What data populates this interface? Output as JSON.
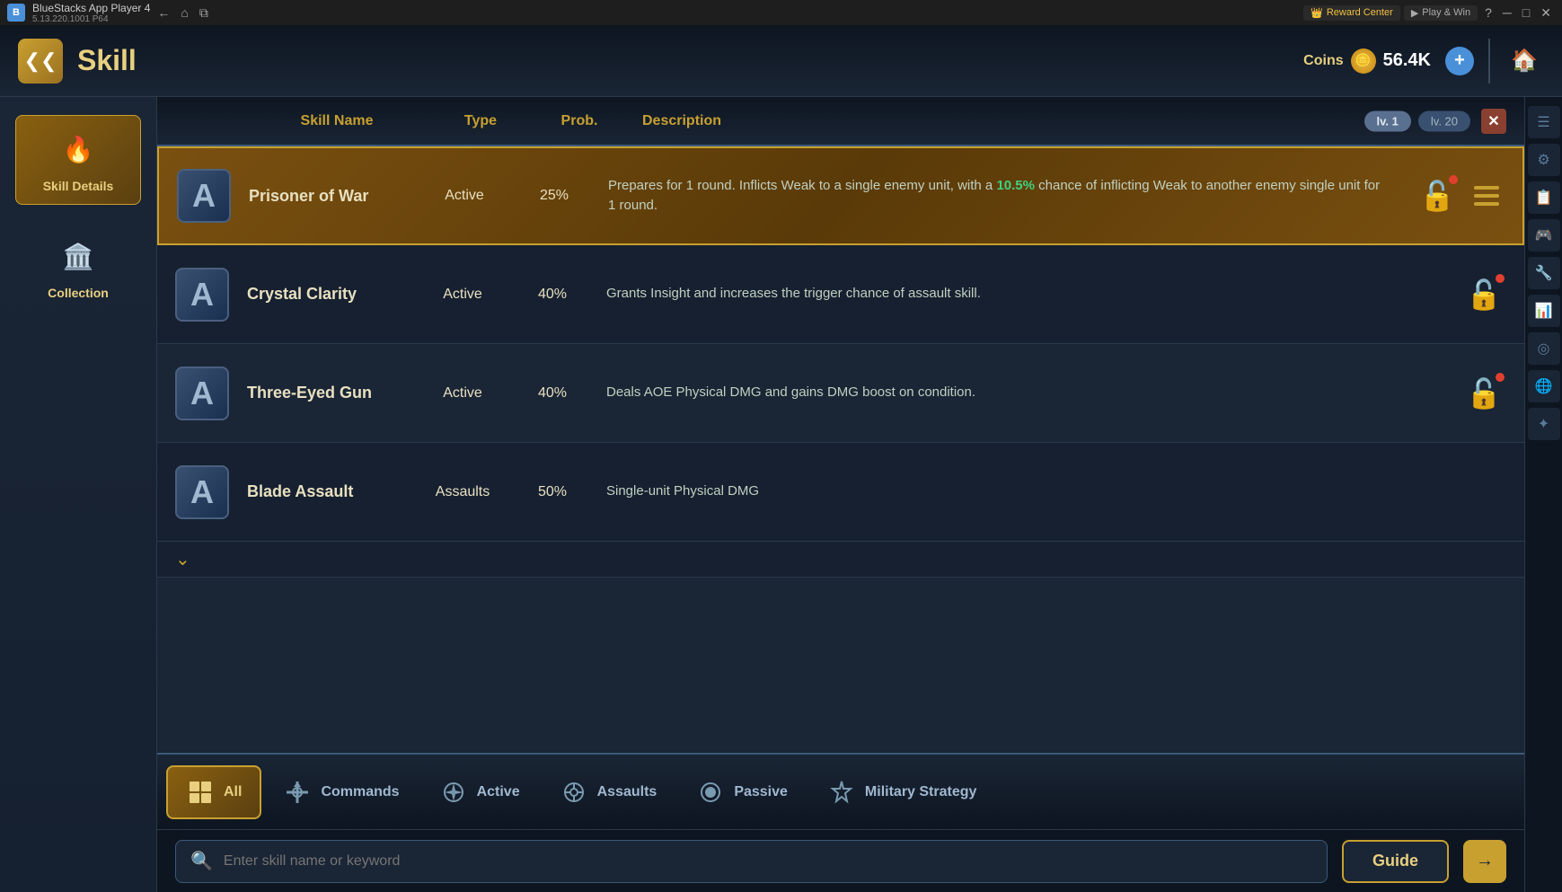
{
  "titleBar": {
    "appName": "BlueStacks App Player 4",
    "version": "5.13.220.1001 P64",
    "rewardCenter": "Reward Center",
    "playWin": "Play & Win"
  },
  "header": {
    "title": "Skill",
    "coins_label": "Coins",
    "coins_amount": "56.4K"
  },
  "sidebar": {
    "items": [
      {
        "label": "Skill Details",
        "icon": "🔥"
      },
      {
        "label": "Collection",
        "icon": "🏛️"
      }
    ]
  },
  "table": {
    "columns": {
      "skillName": "Skill Name",
      "type": "Type",
      "prob": "Prob.",
      "description": "Description"
    },
    "levelButtons": [
      {
        "label": "lv. 1",
        "selected": true
      },
      {
        "label": "lv. 20",
        "selected": false
      }
    ]
  },
  "skills": [
    {
      "letter": "A",
      "name": "Prisoner of War",
      "type": "Active",
      "prob": "25%",
      "description_before": "Prepares for 1 round. Inflicts Weak to a single enemy unit, with a ",
      "description_highlight": "10.5%",
      "description_after": " chance of inflicting Weak to another enemy single unit for 1 round.",
      "highlighted": true,
      "hasMenu": true
    },
    {
      "letter": "A",
      "name": "Crystal Clarity",
      "type": "Active",
      "prob": "40%",
      "description": "Grants Insight and increases the trigger chance of assault skill.",
      "highlighted": false,
      "hasMenu": false
    },
    {
      "letter": "A",
      "name": "Three-Eyed Gun",
      "type": "Active",
      "prob": "40%",
      "description": "Deals AOE Physical DMG and gains DMG boost on condition.",
      "highlighted": false,
      "hasMenu": false
    },
    {
      "letter": "A",
      "name": "Blade Assault",
      "type": "Assaults",
      "prob": "50%",
      "description": "Single-unit Physical DMG",
      "highlighted": false,
      "hasMenu": false
    }
  ],
  "filterBar": {
    "buttons": [
      {
        "label": "All",
        "icon": "⊞",
        "active": true
      },
      {
        "label": "Commands",
        "icon": "⚓",
        "active": false
      },
      {
        "label": "Active",
        "icon": "✳",
        "active": false
      },
      {
        "label": "Assaults",
        "icon": "◎",
        "active": false
      },
      {
        "label": "Passive",
        "icon": "◉",
        "active": false
      },
      {
        "label": "Military Strategy",
        "icon": "✦",
        "active": false
      }
    ]
  },
  "searchBar": {
    "placeholder": "Enter skill name or keyword",
    "guideLabel": "Guide"
  }
}
